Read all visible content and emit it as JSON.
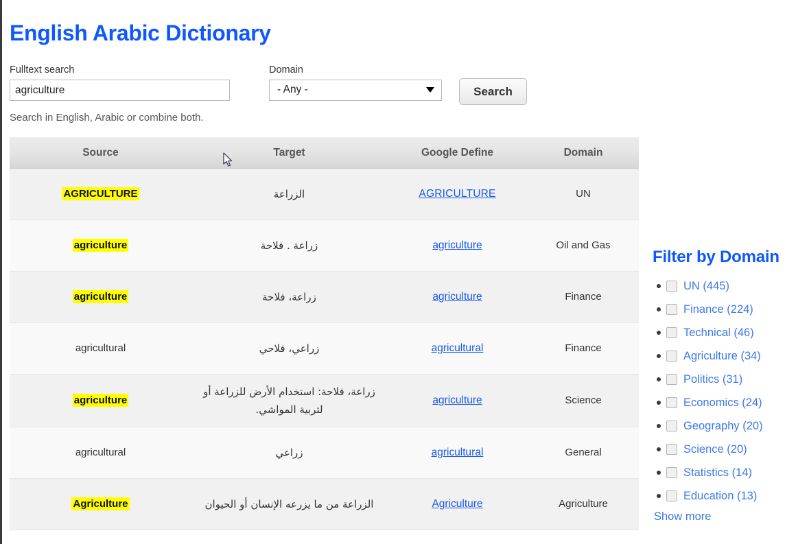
{
  "header": {
    "title": "English Arabic Dictionary"
  },
  "search_form": {
    "fulltext_label": "Fulltext search",
    "fulltext_value": "agriculture",
    "fulltext_placeholder": "",
    "domain_label": "Domain",
    "domain_selected": "- Any -",
    "domain_options": [
      "- Any -"
    ],
    "submit_label": "Search",
    "hint": "Search in English, Arabic or combine both.",
    "dropdown_icon": "chevron-down-icon"
  },
  "results_table": {
    "columns": [
      "Source",
      "Target",
      "Google Define",
      "Domain"
    ],
    "rows": [
      {
        "source": "AGRICULTURE",
        "source_highlighted": true,
        "target": "الزراعة",
        "google_define": "AGRICULTURE",
        "domain": "UN"
      },
      {
        "source": "agriculture",
        "source_highlighted": true,
        "target": "زراعة . فلاحة",
        "google_define": "agriculture",
        "domain": "Oil and Gas"
      },
      {
        "source": "agriculture",
        "source_highlighted": true,
        "target": "زراعة، فلاحة",
        "google_define": "agriculture",
        "domain": "Finance"
      },
      {
        "source": "agricultural",
        "source_highlighted": false,
        "target": "زراعي، فلاحي",
        "google_define": "agricultural",
        "domain": "Finance"
      },
      {
        "source": "agriculture",
        "source_highlighted": true,
        "target": "زراعة، فلاحة: استخدام الأرض للزراعة أو لتربية المواشي.",
        "google_define": "agriculture",
        "domain": "Science"
      },
      {
        "source": "agricultural",
        "source_highlighted": false,
        "target": "زراعي",
        "google_define": "agricultural",
        "domain": "General"
      },
      {
        "source": "Agriculture",
        "source_highlighted": true,
        "target": "الزراعة من ما يزرعه الإنسان أو الحيوان",
        "google_define": "Agriculture",
        "domain": "Agriculture"
      }
    ]
  },
  "sidebar": {
    "title": "Filter by Domain",
    "facets": [
      {
        "label": "UN (445)",
        "checked": false
      },
      {
        "label": "Finance (224)",
        "checked": false
      },
      {
        "label": "Technical (46)",
        "checked": false
      },
      {
        "label": "Agriculture (34)",
        "checked": false
      },
      {
        "label": "Politics (31)",
        "checked": false
      },
      {
        "label": "Economics (24)",
        "checked": false
      },
      {
        "label": "Geography (20)",
        "checked": false
      },
      {
        "label": "Science (20)",
        "checked": false
      },
      {
        "label": "Statistics (14)",
        "checked": false
      },
      {
        "label": "Education (13)",
        "checked": false
      }
    ],
    "show_more_label": "Show more"
  },
  "colors": {
    "title_blue": "#0f58ff",
    "link_blue": "#3d78e8",
    "highlight_yellow": "#ffff00",
    "row_odd": "#f1f1f1",
    "row_even": "#f9f9f9"
  }
}
